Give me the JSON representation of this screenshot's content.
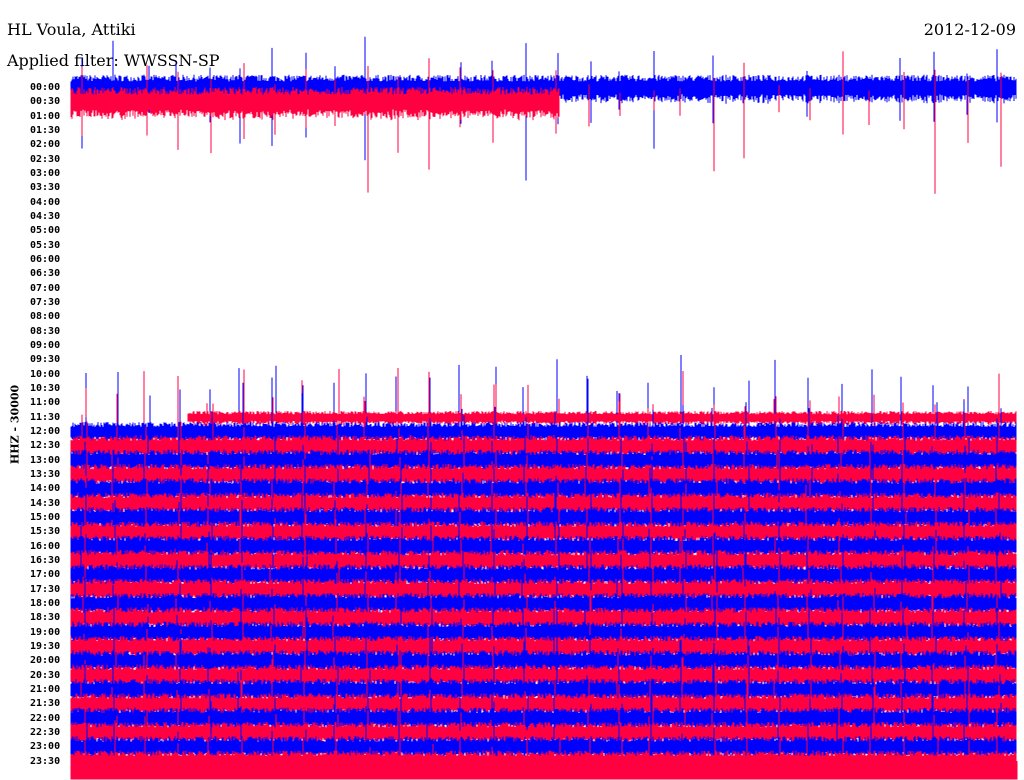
{
  "header": {
    "station": "HL Voula, Attiki",
    "filter": "Applied filter: WWSSN-SP",
    "date": "2012-12-09"
  },
  "chart_data": {
    "type": "line",
    "title": "HL Voula, Attiki",
    "subtitle": "Applied filter: WWSSN-SP",
    "ylabel": "HHZ - 30000",
    "minutes_per_row": 30,
    "spike_interval_min": 1,
    "colors": [
      "#0000ff",
      "#ff0040"
    ],
    "row_labels": [
      "00:00",
      "00:30",
      "01:00",
      "01:30",
      "02:00",
      "02:30",
      "03:00",
      "03:30",
      "04:00",
      "04:30",
      "05:00",
      "05:30",
      "06:00",
      "06:30",
      "07:00",
      "07:30",
      "08:00",
      "08:30",
      "09:00",
      "09:30",
      "10:00",
      "10:30",
      "11:00",
      "11:30",
      "12:00",
      "12:30",
      "13:00",
      "13:30",
      "14:00",
      "14:30",
      "15:00",
      "15:30",
      "16:00",
      "16:30",
      "17:00",
      "17:30",
      "18:00",
      "18:30",
      "19:00",
      "19:30",
      "20:00",
      "20:30",
      "21:00",
      "21:30",
      "22:00",
      "22:30",
      "23:00",
      "23:30"
    ],
    "data_ranges": [
      {
        "row": "00:00",
        "start_min": 0,
        "end_min": 30,
        "amplitude": 1.2
      },
      {
        "row": "00:30",
        "start_min": 0,
        "end_min": 15.5,
        "amplitude": 1.4
      },
      {
        "row": "11:30",
        "start_min": 3.7,
        "end_min": 30,
        "amplitude": 0.6
      },
      {
        "row": "12:00",
        "start_min": 0,
        "end_min": 30,
        "amplitude": 0.9
      },
      {
        "row": "12:30..23:30",
        "start_min": 0,
        "end_min": 30,
        "amplitude": 1.0
      }
    ]
  }
}
